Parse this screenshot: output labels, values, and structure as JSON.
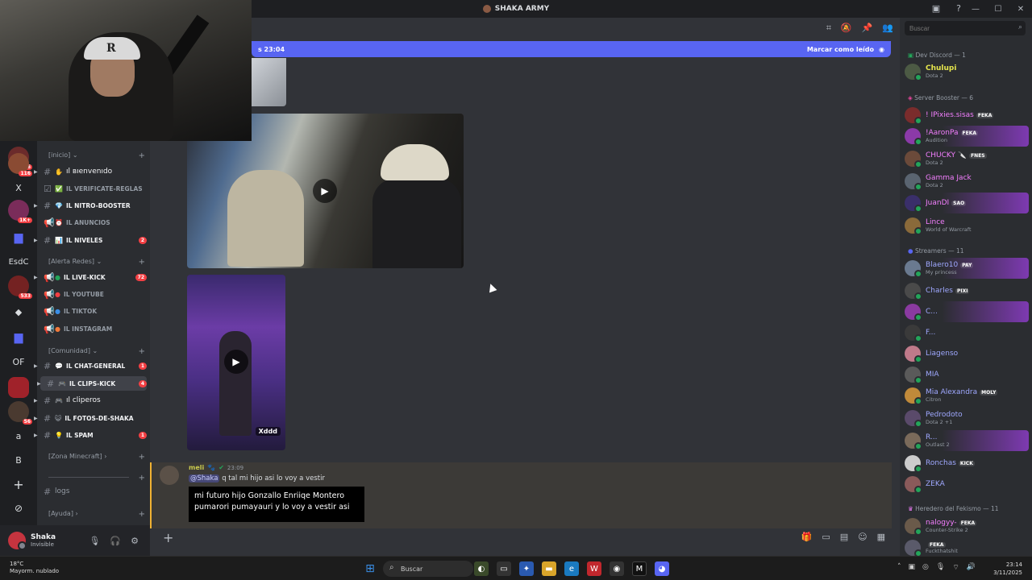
{
  "window": {
    "title": "SHAKA ARMY"
  },
  "rail": {
    "badges": [
      "16",
      "116",
      "1K+",
      "533",
      "56"
    ],
    "letters": [
      "X",
      "EsdC",
      "OF",
      "a",
      "B"
    ]
  },
  "channels": {
    "categories": {
      "inicio": "[inicio]",
      "alerta": "[Alerta Redes]",
      "comunidad": "[Comunidad]",
      "minecraft": "[Zona Minecraft]",
      "ayuda": "[Ayuda]"
    },
    "items": [
      {
        "name": "ıl вıenvenıdo",
        "count": ""
      },
      {
        "name": "ıl verificate-reglas",
        "count": ""
      },
      {
        "name": "ıl nitro-booster",
        "count": ""
      },
      {
        "name": "ıl anuncios",
        "count": ""
      },
      {
        "name": "ıl niveles",
        "count": "2"
      },
      {
        "name": "ıl live-kick",
        "count": "72"
      },
      {
        "name": "ıl youtube",
        "count": ""
      },
      {
        "name": "ıl tiktok",
        "count": ""
      },
      {
        "name": "ıl instagram",
        "count": ""
      },
      {
        "name": "ıl chat-general",
        "count": "1"
      },
      {
        "name": "ıl clips-kick",
        "count": "4"
      },
      {
        "name": "ıl cliperos",
        "count": ""
      },
      {
        "name": "ıl fotos-de-shaka",
        "count": ""
      },
      {
        "name": "ıl spam",
        "count": "1"
      },
      {
        "name": "logs",
        "count": ""
      }
    ]
  },
  "user": {
    "name": "Shaka",
    "status": "Invisible"
  },
  "newbar": {
    "left": "s 23:04",
    "mark": "Marcar como leído"
  },
  "media": {
    "caption": "Xddd"
  },
  "message": {
    "author": "meli",
    "time": "23:09",
    "mention": "@Shaka",
    "text": "q tal mi hijo asi lo voy a vestir",
    "bubble": "mi futuro hijo Gonzallo Enriiqe Montero pumarori pumayauri  y lo voy a vestir asi"
  },
  "members": {
    "search_placeholder": "Buscar",
    "groups": {
      "dev": "Dev Discord — 1",
      "booster": "Server Booster — 6",
      "streamers": "Streamers — 11",
      "heredero": "Heredero del Fekismo — 11"
    },
    "list": [
      {
        "name": "Chulupi",
        "activity": "Dota 2",
        "tag": ""
      },
      {
        "name": "! IPixies.sisas",
        "activity": "",
        "tag": "FEKA"
      },
      {
        "name": "!AaronPa",
        "activity": "Audition",
        "tag": "FEKA"
      },
      {
        "name": "CHUCKY 🔪",
        "activity": "Dota 2",
        "tag": "FNES"
      },
      {
        "name": "Gamma Jack",
        "activity": "Dota 2",
        "tag": ""
      },
      {
        "name": "JuanDI",
        "activity": "",
        "tag": "SAO"
      },
      {
        "name": "Lince",
        "activity": "World of Warcraft",
        "tag": ""
      },
      {
        "name": "Blaero10",
        "activity": "My princess",
        "tag": "PAY"
      },
      {
        "name": "Charles",
        "activity": "",
        "tag": "PIXI"
      },
      {
        "name": "C...",
        "activity": "",
        "tag": ""
      },
      {
        "name": "F...",
        "activity": "",
        "tag": ""
      },
      {
        "name": "Liagenso",
        "activity": "",
        "tag": ""
      },
      {
        "name": "MIA",
        "activity": "",
        "tag": ""
      },
      {
        "name": "Mia Alexandra",
        "activity": "Citron",
        "tag": "MOLY"
      },
      {
        "name": "Pedrodoto",
        "activity": "Dota 2 +1",
        "tag": ""
      },
      {
        "name": "R...",
        "activity": "Outlast 2",
        "tag": ""
      },
      {
        "name": "Ronchas",
        "activity": "",
        "tag": "KICK"
      },
      {
        "name": "ZEKA",
        "activity": "",
        "tag": ""
      },
      {
        "name": "nalogyy-",
        "activity": "Counter-Strike 2",
        "tag": "FEKA"
      },
      {
        "name": "",
        "activity": "Fuckthatshit",
        "tag": "FEKA"
      }
    ]
  },
  "taskbar": {
    "weather_temp": "18°C",
    "weather_desc": "Mayorm. nublado",
    "search": "Buscar",
    "time": "23:14",
    "date": "3/11/2025"
  },
  "colors": {
    "accent": "#5865f2",
    "danger": "#f23f43",
    "online": "#23a55a"
  }
}
